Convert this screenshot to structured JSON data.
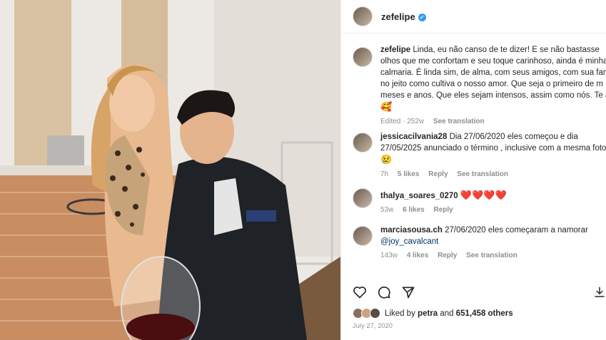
{
  "post_header": {
    "username": "zefelipe"
  },
  "caption": {
    "username": "zefelipe",
    "lines": [
      "Linda, eu não canso de te dizer! E se não bastasse",
      "olhos que me confortam e seu toque carinhoso, ainda é minha",
      "calmaria. É linda sim, de alma, com seus amigos, com sua fami",
      "no jeito como cultiva o nosso amor. Que seja o primeiro de m",
      "meses e anos. Que eles sejam intensos, assim como nós. Te an"
    ],
    "emoji": "🥰",
    "edited": "Edited · 252w",
    "see_translation": "See translation"
  },
  "comments": [
    {
      "username": "jessicacilvania28",
      "lines": [
        "Dia 27/06/2020 eles começou e dia",
        "27/05/2025 anunciado o término , inclusive com a mesma foto"
      ],
      "emoji": "😢",
      "time": "7h",
      "likes": "5 likes",
      "reply": "Reply",
      "see_translation": "See translation"
    },
    {
      "username": "thalya_soares_0270",
      "hearts": "❤️❤️❤️❤️",
      "time": "53w",
      "likes": "6 likes",
      "reply": "Reply"
    },
    {
      "username": "marciasousa.ch",
      "text": "27/06/2020 eles começaram a namorar",
      "mention": "@joy_cavalcant",
      "time": "143w",
      "likes": "4 likes",
      "reply": "Reply",
      "see_translation": "See translation"
    }
  ],
  "likes": {
    "prefix": "Liked by",
    "user": "petra",
    "and": "and",
    "count": "651,458 others"
  },
  "date": "July 27, 2020",
  "colors": {
    "verified": "#3897f0",
    "link": "#00376b",
    "meta": "#8e8e8e"
  },
  "icons": [
    "heart-icon",
    "comment-icon",
    "share-icon",
    "save-icon",
    "verified-icon"
  ]
}
